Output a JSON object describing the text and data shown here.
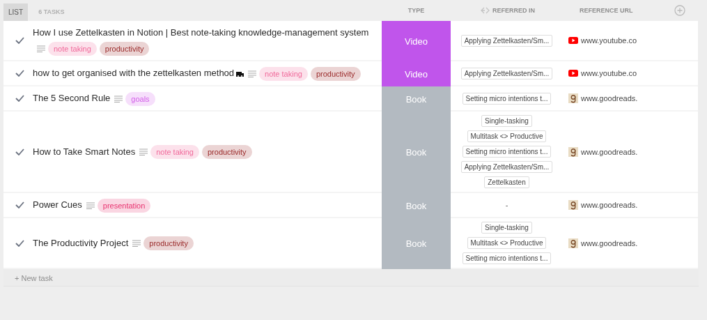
{
  "view_tab": {
    "label": "LIST",
    "selected": true
  },
  "task_count": "6 TASKS",
  "columns": [
    {
      "label": "TYPE"
    },
    {
      "label": "REFERRED IN"
    },
    {
      "label": "REFERENCE URL"
    }
  ],
  "tasks": [
    {
      "checked": true,
      "title": "How I use Zettelkasten in Notion | Best note-taking knowledge-management system",
      "emoji": false,
      "tags": [
        {
          "label": "note taking",
          "color": "#f0699a"
        },
        {
          "label": "productivity",
          "color": "#9a2a2a"
        }
      ],
      "type": {
        "label": "Video",
        "kind": "video",
        "color": "#c055eb"
      },
      "referred_in": [
        "Applying Zettelkasten/Sm..."
      ],
      "url": {
        "text": "www.youtube.co"
      }
    },
    {
      "checked": true,
      "title": "how to get organised with the zettelkasten method",
      "emoji": true,
      "tags": [
        {
          "label": "note taking",
          "color": "#f0699a"
        },
        {
          "label": "productivity",
          "color": "#9a2a2a"
        }
      ],
      "type": {
        "label": "Video",
        "kind": "video",
        "color": "#c055eb"
      },
      "referred_in": [
        "Applying Zettelkasten/Sm..."
      ],
      "url": {
        "text": "www.youtube.co"
      }
    },
    {
      "checked": true,
      "title": "The 5 Second Rule",
      "emoji": false,
      "tags": [
        {
          "label": "goals",
          "color": "#d35ee9"
        }
      ],
      "type": {
        "label": "Book",
        "kind": "book",
        "color": "#b3bac1"
      },
      "referred_in": [
        "Setting micro intentions t..."
      ],
      "url": {
        "text": "www.goodreads."
      }
    },
    {
      "checked": true,
      "title": "How to Take Smart Notes",
      "emoji": false,
      "tags": [
        {
          "label": "note taking",
          "color": "#f0699a"
        },
        {
          "label": "productivity",
          "color": "#9a2a2a"
        }
      ],
      "type": {
        "label": "Book",
        "kind": "book",
        "color": "#b3bac1"
      },
      "referred_in": [
        "Single-tasking",
        "Multitask <> Productive",
        "Setting micro intentions t...",
        "Applying Zettelkasten/Sm...",
        "Zettelkasten"
      ],
      "url": {
        "text": "www.goodreads."
      }
    },
    {
      "checked": true,
      "title": "Power Cues",
      "emoji": false,
      "tags": [
        {
          "label": "presentation",
          "color": "#e8336f"
        }
      ],
      "type": {
        "label": "Book",
        "kind": "book",
        "color": "#b3bac1"
      },
      "referred_in_placeholder": "-",
      "url": {
        "text": "www.goodreads."
      }
    },
    {
      "checked": true,
      "title": "The Productivity Project",
      "emoji": false,
      "tags": [
        {
          "label": "productivity",
          "color": "#9a2a2a"
        }
      ],
      "type": {
        "label": "Book",
        "kind": "book",
        "color": "#b3bac1"
      },
      "referred_in": [
        "Single-tasking",
        "Multitask <> Productive",
        "Setting micro intentions t..."
      ],
      "url": {
        "text": "www.goodreads."
      }
    }
  ],
  "new_task": "+ New task"
}
